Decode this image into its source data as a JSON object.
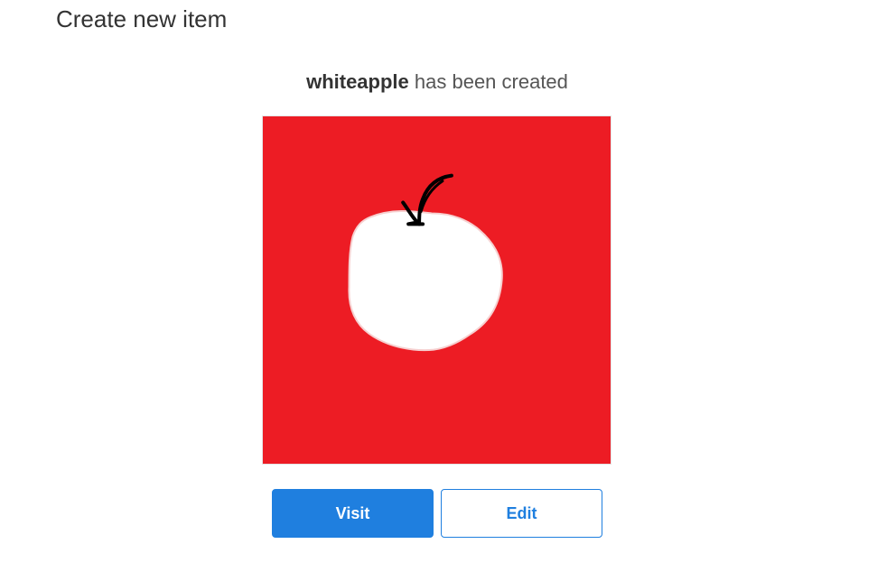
{
  "page": {
    "title": "Create new item"
  },
  "status": {
    "item_name": "whiteapple",
    "message": "has been created"
  },
  "preview": {
    "icon": "apple-drawing",
    "background_color": "#ed1c24",
    "fruit_color": "#ffffff",
    "stem_color": "#000000"
  },
  "actions": {
    "visit_label": "Visit",
    "edit_label": "Edit",
    "accent_color": "#1f7fdf"
  }
}
